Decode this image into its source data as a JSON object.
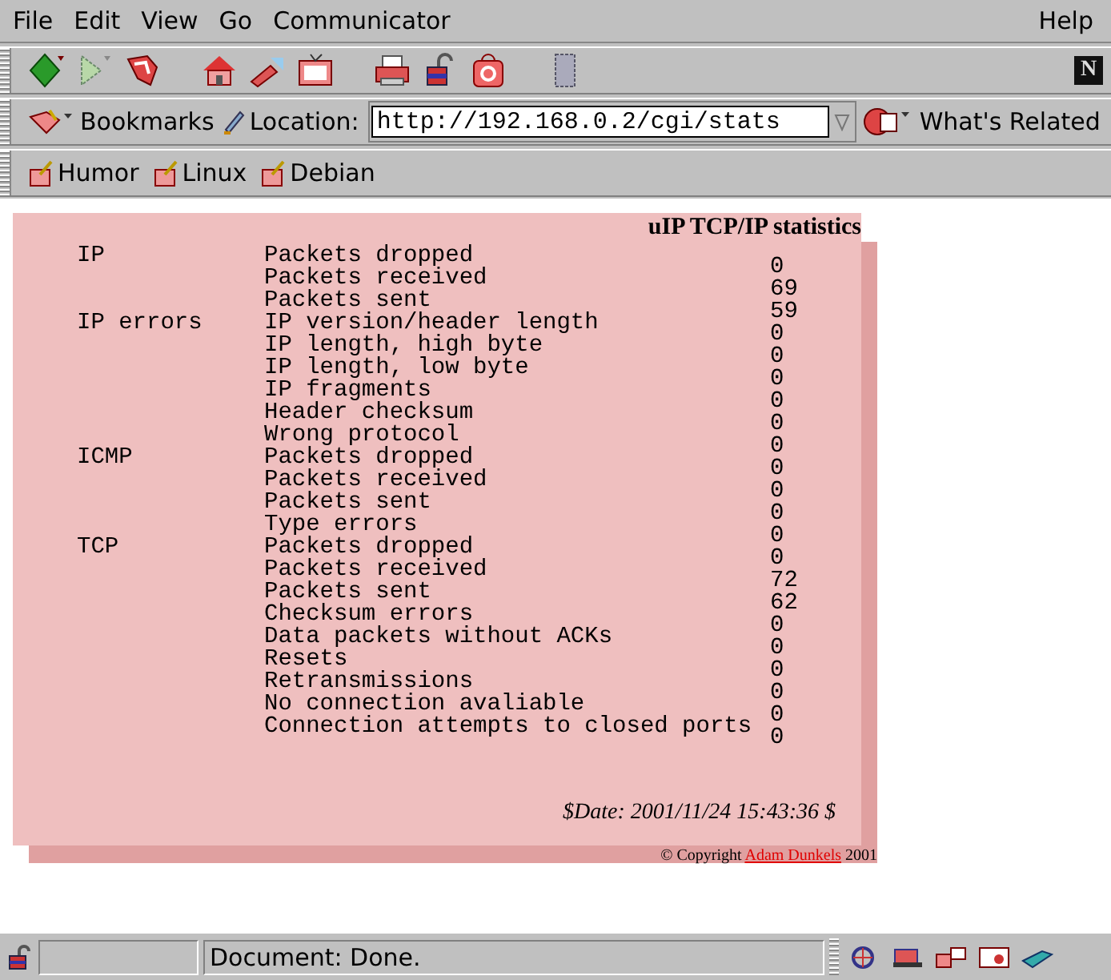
{
  "menu": {
    "left": [
      "File",
      "Edit",
      "View",
      "Go",
      "Communicator"
    ],
    "right": "Help"
  },
  "toolbar": {
    "logo": "N"
  },
  "location_bar": {
    "bookmarks": "Bookmarks",
    "label": "Location:",
    "url": "http://192.168.0.2/cgi/stats",
    "whats_related": "What's Related"
  },
  "personal_bar": [
    "Humor",
    "Linux",
    "Debian"
  ],
  "page": {
    "title": "uIP TCP/IP statistics",
    "sections": [
      {
        "label": "IP",
        "rows": [
          {
            "name": "Packets dropped",
            "value": "0"
          },
          {
            "name": "Packets received",
            "value": "69"
          },
          {
            "name": "Packets sent",
            "value": "59"
          }
        ]
      },
      {
        "label": "IP errors",
        "rows": [
          {
            "name": "IP version/header length",
            "value": "0"
          },
          {
            "name": "IP length, high byte",
            "value": "0"
          },
          {
            "name": "IP length, low byte",
            "value": "0"
          },
          {
            "name": "IP fragments",
            "value": "0"
          },
          {
            "name": "Header checksum",
            "value": "0"
          },
          {
            "name": "Wrong protocol",
            "value": "0"
          }
        ]
      },
      {
        "label": "ICMP",
        "rows": [
          {
            "name": "Packets dropped",
            "value": "0"
          },
          {
            "name": "Packets received",
            "value": "0"
          },
          {
            "name": "Packets sent",
            "value": "0"
          },
          {
            "name": "Type errors",
            "value": "0"
          }
        ]
      },
      {
        "label": "TCP",
        "rows": [
          {
            "name": "Packets dropped",
            "value": "0"
          },
          {
            "name": "Packets received",
            "value": "72"
          },
          {
            "name": "Packets sent",
            "value": "62"
          },
          {
            "name": "Checksum errors",
            "value": "0"
          },
          {
            "name": "Data packets without ACKs",
            "value": "0"
          },
          {
            "name": "Resets",
            "value": "0"
          },
          {
            "name": "Retransmissions",
            "value": "0"
          },
          {
            "name": "No connection avaliable",
            "value": "0"
          },
          {
            "name": "Connection attempts to closed ports",
            "value": "0"
          }
        ]
      }
    ],
    "date": "$Date: 2001/11/24 15:43:36 $",
    "copyright": "© Copyright",
    "author": "Adam Dunkels",
    "year": "2001"
  },
  "status_bar": {
    "text": "Document: Done."
  }
}
